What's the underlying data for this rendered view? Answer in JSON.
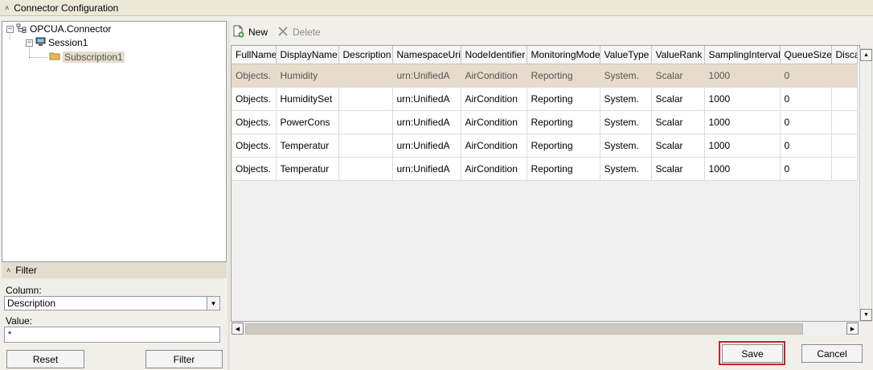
{
  "config_header": {
    "title": "Connector Configuration",
    "icon": "collapse-chevron-icon"
  },
  "tree": {
    "root": "OPCUA.Connector",
    "session": "Session1",
    "subscription": "Subscription1"
  },
  "filter": {
    "header": "Filter",
    "column_label": "Column:",
    "column_value": "Description",
    "value_label": "Value:",
    "value_value": "*",
    "reset_label": "Reset",
    "filter_label": "Filter"
  },
  "toolbar": {
    "new_label": "New",
    "delete_label": "Delete"
  },
  "grid": {
    "columns": [
      "FullName",
      "DisplayName",
      "Description",
      "NamespaceUri",
      "NodeIdentifier",
      "MonitoringMode",
      "ValueType",
      "ValueRank",
      "SamplingInterval",
      "QueueSize",
      "Disca"
    ],
    "rows": [
      [
        "Objects.",
        "Humidity",
        "",
        "urn:UnifiedA",
        "AirCondition",
        "Reporting",
        "System.",
        "Scalar",
        "1000",
        "0",
        ""
      ],
      [
        "Objects.",
        "HumiditySet",
        "",
        "urn:UnifiedA",
        "AirCondition",
        "Reporting",
        "System.",
        "Scalar",
        "1000",
        "0",
        ""
      ],
      [
        "Objects.",
        "PowerCons",
        "",
        "urn:UnifiedA",
        "AirCondition",
        "Reporting",
        "System.",
        "Scalar",
        "1000",
        "0",
        ""
      ],
      [
        "Objects.",
        "Temperatur",
        "",
        "urn:UnifiedA",
        "AirCondition",
        "Reporting",
        "System.",
        "Scalar",
        "1000",
        "0",
        ""
      ],
      [
        "Objects.",
        "Temperatur",
        "",
        "urn:UnifiedA",
        "AirCondition",
        "Reporting",
        "System.",
        "Scalar",
        "1000",
        "0",
        ""
      ]
    ],
    "selected_row": 0
  },
  "actions": {
    "save_label": "Save",
    "cancel_label": "Cancel"
  },
  "colors": {
    "selection": "#e7dccc",
    "save_highlight": "#c0262d",
    "panel_bg": "#f0efe9"
  }
}
